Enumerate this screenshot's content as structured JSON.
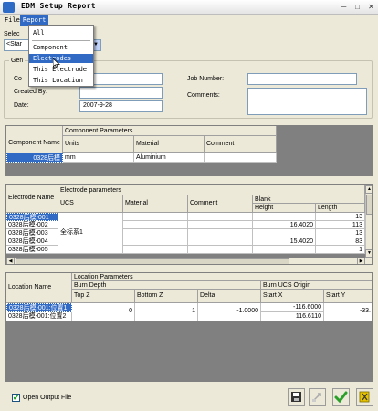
{
  "window": {
    "title": "EDM Setup Report",
    "icon": "app-icon"
  },
  "menu": {
    "file": "File",
    "report": "Report"
  },
  "report_menu": {
    "items": [
      "All",
      "Component",
      "Electrodes",
      "This Electrode",
      "This Location"
    ],
    "selected": "Electrodes"
  },
  "select": {
    "label": "Selec",
    "value": "<Star"
  },
  "general": {
    "label": "Gen",
    "component_label": "Co",
    "created_by_label": "Created By:",
    "created_by_value": "",
    "date_label": "Date:",
    "date_value": "2007-9-28",
    "job_number_label": "Job Number:",
    "job_number_value": "",
    "comments_label": "Comments:",
    "comments_value": ""
  },
  "component_grid": {
    "row_header": "Component Name",
    "group_header": "Component Parameters",
    "columns": [
      "Units",
      "Material",
      "Comment"
    ],
    "rows": [
      {
        "name": "0328后模",
        "units": "mm",
        "material": "Aluminium",
        "comment": ""
      }
    ]
  },
  "electrode_grid": {
    "row_header": "Electrode Name",
    "group_header": "Electrode parameters",
    "columns": [
      "UCS",
      "Material",
      "Comment"
    ],
    "blank_header": "Blank",
    "blank_columns": [
      "Height",
      "Length"
    ],
    "ucs_value": "全标系1",
    "rows": [
      {
        "name": "0328后模-001",
        "height": "",
        "length": "13"
      },
      {
        "name": "0328后模-002",
        "height": "16.4020",
        "length": "113"
      },
      {
        "name": "0328后模-003",
        "height": "",
        "length": "13"
      },
      {
        "name": "0328后模-004",
        "height": "15.4020",
        "length": "83"
      },
      {
        "name": "0328后模-005",
        "height": "",
        "length": "1"
      }
    ]
  },
  "location_grid": {
    "row_header": "Location Name",
    "group_header": "Location Parameters",
    "burn_depth_header": "Burn Depth",
    "burn_depth_columns": [
      "Top Z",
      "Bottom Z",
      "Delta"
    ],
    "burn_ucs_header": "Burn UCS Origin",
    "burn_ucs_columns": [
      "Start X",
      "Start Y"
    ],
    "rows": [
      {
        "name": "0328后模-001:位置1",
        "top_z": "0",
        "bottom_z": "1",
        "delta": "-1.0000",
        "start_x": "-116.6000",
        "start_y": "-33."
      },
      {
        "name": "0328后模-001:位置2",
        "top_z": "",
        "bottom_z": "",
        "delta": "",
        "start_x": "116.6110",
        "start_y": ""
      }
    ]
  },
  "footer": {
    "open_output_label": "Open Output File",
    "open_output_checked": true
  },
  "toolbar_icons": [
    "save-icon",
    "disabled-tool-icon",
    "check-icon",
    "exit-icon"
  ]
}
